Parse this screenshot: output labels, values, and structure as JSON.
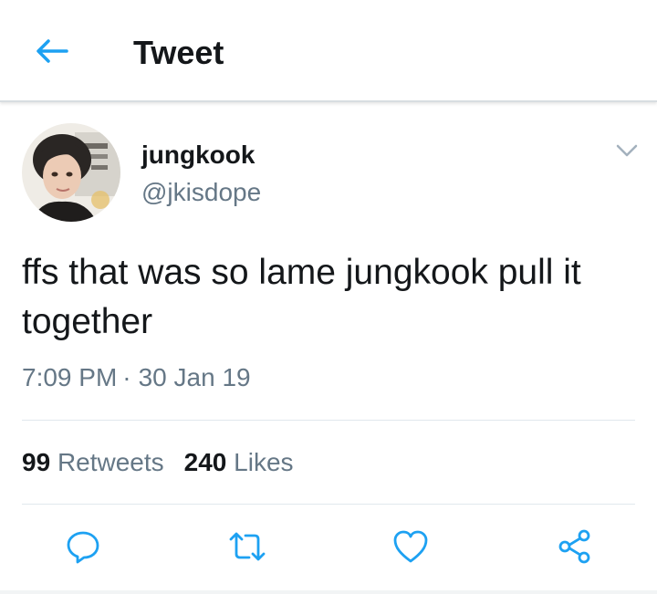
{
  "header": {
    "title": "Tweet",
    "back_icon": "arrow-left-icon"
  },
  "tweet": {
    "author": {
      "display_name": "jungkook",
      "handle": "@jkisdope"
    },
    "text": "ffs that was so lame jungkook pull it together",
    "time": "7:09 PM",
    "separator": "·",
    "date": "30 Jan 19",
    "stats": {
      "retweets_count": "99",
      "retweets_label": "Retweets",
      "likes_count": "240",
      "likes_label": "Likes"
    },
    "actions": [
      "reply-icon",
      "retweet-icon",
      "like-icon",
      "share-icon"
    ]
  },
  "colors": {
    "accent": "#1da1f2",
    "text": "#14171a",
    "secondary": "#657786",
    "border": "#e1e8ed"
  }
}
